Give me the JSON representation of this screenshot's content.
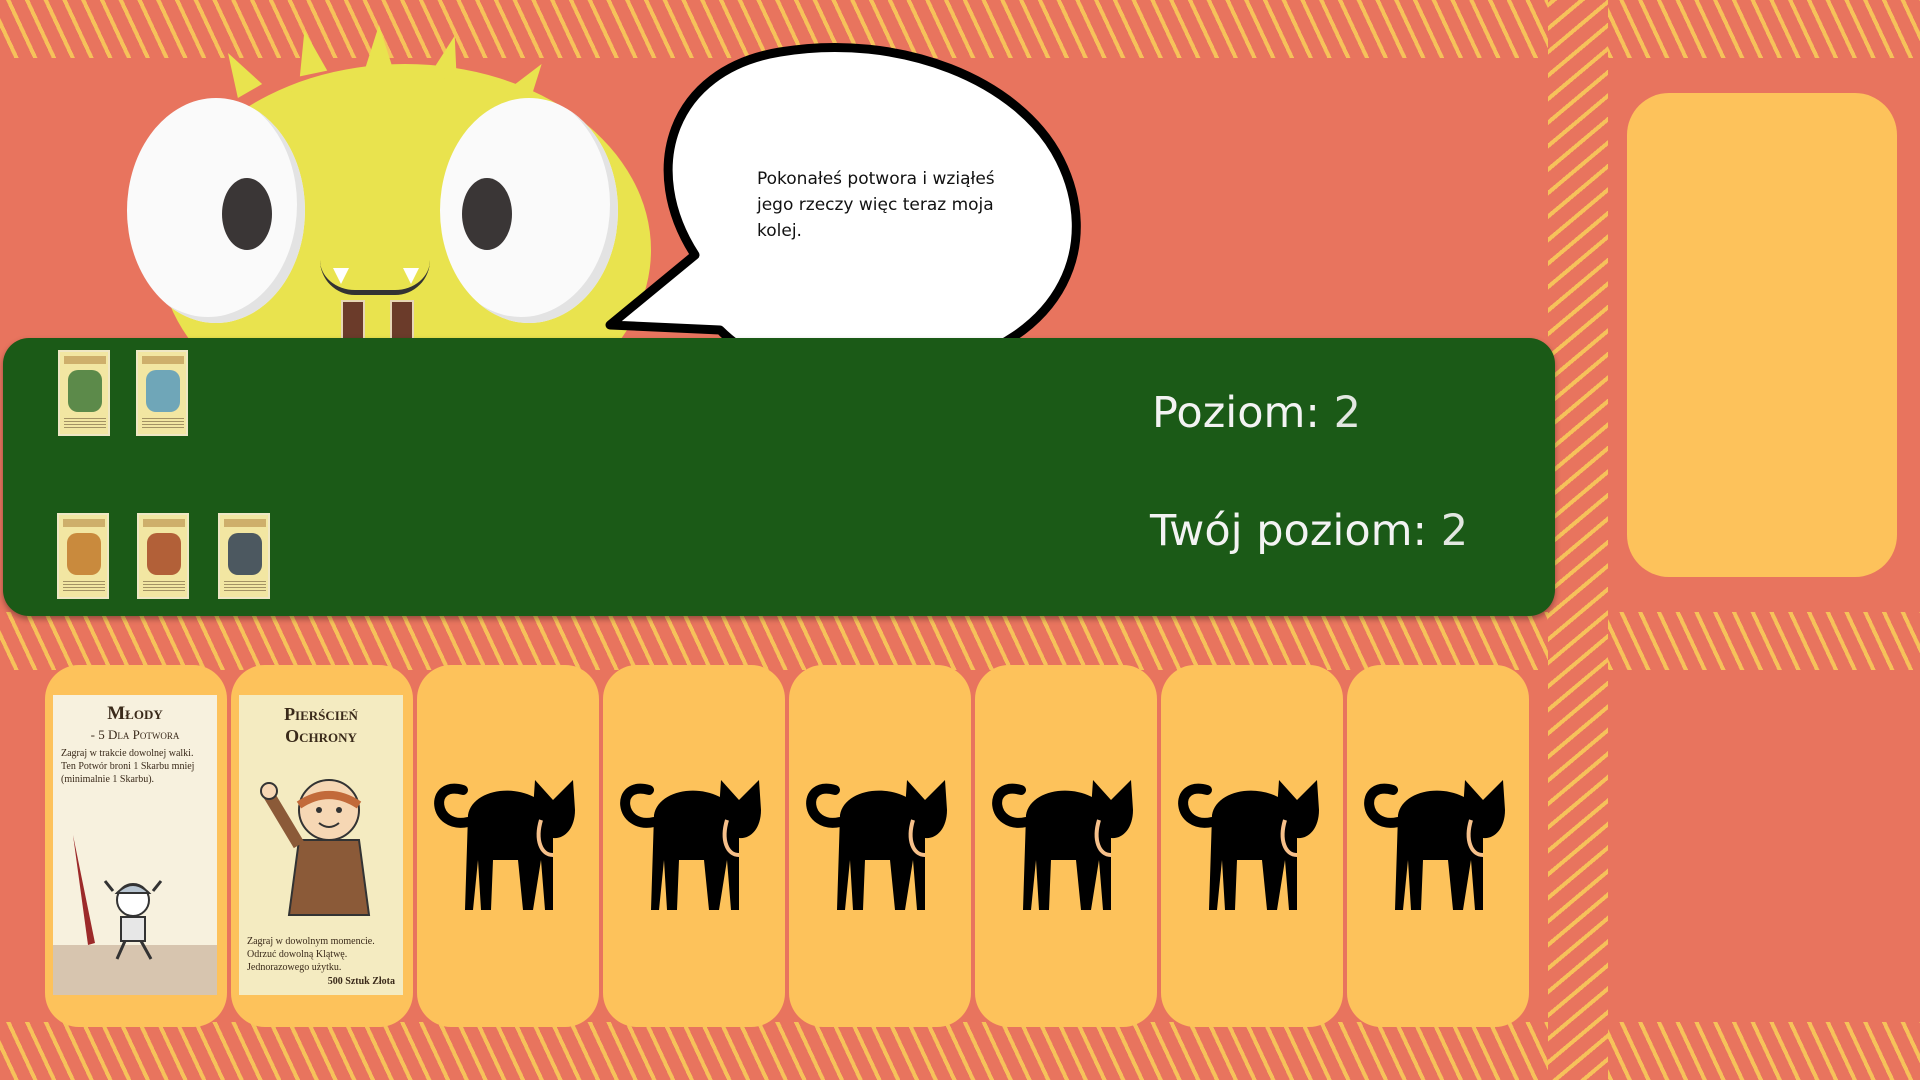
{
  "speech": {
    "text": "Pokonałeś potwora i wziąłeś jego rzeczy więc teraz moja kolej."
  },
  "board": {
    "monster_level_label": "Poziom:",
    "monster_level_value": "2",
    "player_level_label": "Twój poziom:",
    "player_level_value": "2",
    "monster_items": [
      {
        "icon": "sword-card-icon"
      },
      {
        "icon": "curse-card-icon"
      }
    ],
    "player_items": [
      {
        "icon": "warrior-card-icon"
      },
      {
        "icon": "chainsaw-card-icon"
      },
      {
        "icon": "boots-card-icon"
      }
    ]
  },
  "hand": {
    "cards": [
      {
        "title": "Młody",
        "subtitle": "- 5 Dla Potwora",
        "text": "Zagraj w trakcie dowolnej walki. Ten Potwór broni 1 Skarbu mniej (minimalnie 1 Skarbu)."
      },
      {
        "title": "Pierścień Ochrony",
        "text": "Zagraj w dowolnym momencie. Odrzuć dowolną Klątwę. Jednorazowego użytku.",
        "price": "500 Sztuk Złota"
      }
    ],
    "hidden_cards": 6
  },
  "colors": {
    "background": "#e8745e",
    "stripe": "#f6c25a",
    "slot": "#fdc25b",
    "board": "#1b5a17",
    "monster": "#e9e34e"
  }
}
